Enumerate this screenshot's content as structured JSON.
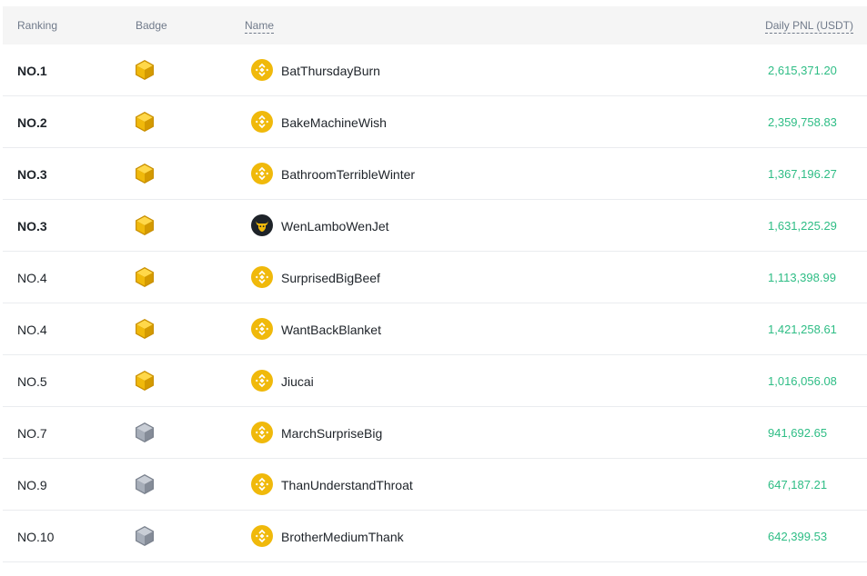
{
  "columns": {
    "ranking": "Ranking",
    "badge": "Badge",
    "name": "Name",
    "pnl": "Daily PNL (USDT)"
  },
  "colors": {
    "pnl_positive": "#2ebd85",
    "badge_gold": "#f0b90b",
    "badge_silver": "#9aa1ad",
    "avatar_default": "#f0b90b",
    "avatar_dark": "#1e2329"
  },
  "rows": [
    {
      "rank": "NO.1",
      "badge": "gold-badge-icon",
      "avatar": "binance-avatar-icon",
      "name": "BatThursdayBurn",
      "pnl": "2,615,371.20"
    },
    {
      "rank": "NO.2",
      "badge": "gold-badge-icon",
      "avatar": "binance-avatar-icon",
      "name": "BakeMachineWish",
      "pnl": "2,359,758.83"
    },
    {
      "rank": "NO.3",
      "badge": "gold-badge-icon",
      "avatar": "binance-avatar-icon",
      "name": "BathroomTerribleWinter",
      "pnl": "1,367,196.27"
    },
    {
      "rank": "NO.3",
      "badge": "gold-badge-icon",
      "avatar": "bull-avatar-icon",
      "name": "WenLamboWenJet",
      "pnl": "1,631,225.29"
    },
    {
      "rank": "NO.4",
      "badge": "gold-badge-icon",
      "avatar": "binance-avatar-icon",
      "name": "SurprisedBigBeef",
      "pnl": "1,113,398.99"
    },
    {
      "rank": "NO.4",
      "badge": "gold-badge-icon",
      "avatar": "binance-avatar-icon",
      "name": "WantBackBlanket",
      "pnl": "1,421,258.61"
    },
    {
      "rank": "NO.5",
      "badge": "gold-badge-icon",
      "avatar": "binance-avatar-icon",
      "name": "Jiucai",
      "pnl": "1,016,056.08"
    },
    {
      "rank": "NO.7",
      "badge": "silver-badge-icon",
      "avatar": "binance-avatar-icon",
      "name": "MarchSurpriseBig",
      "pnl": "941,692.65"
    },
    {
      "rank": "NO.9",
      "badge": "silver-badge-icon",
      "avatar": "binance-avatar-icon",
      "name": "ThanUnderstandThroat",
      "pnl": "647,187.21"
    },
    {
      "rank": "NO.10",
      "badge": "silver-badge-icon",
      "avatar": "binance-avatar-icon",
      "name": "BrotherMediumThank",
      "pnl": "642,399.53"
    }
  ]
}
